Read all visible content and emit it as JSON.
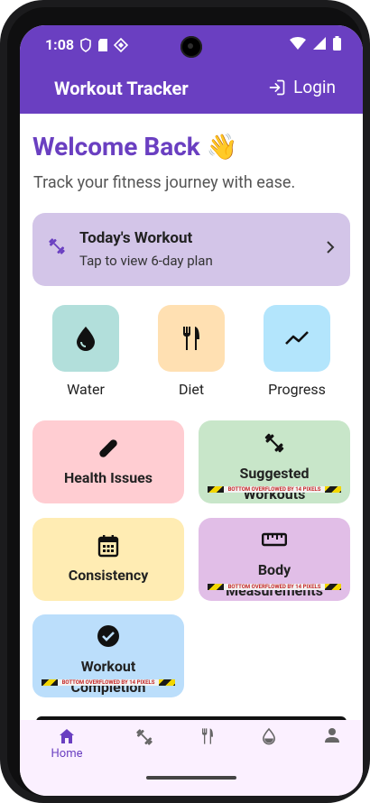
{
  "status_bar": {
    "time": "1:08"
  },
  "app_bar": {
    "title": "Workout Tracker",
    "login_label": "Login"
  },
  "welcome": {
    "title": "Welcome Back 👋",
    "subtitle": "Track your fitness journey with ease."
  },
  "today_card": {
    "title": "Today's Workout",
    "subtitle": "Tap to view 6-day plan"
  },
  "quick_actions": [
    {
      "label": "Water",
      "icon": "water-drop-icon",
      "color": "#b2dfdb"
    },
    {
      "label": "Diet",
      "icon": "fork-knife-icon",
      "color": "#ffe0b2"
    },
    {
      "label": "Progress",
      "icon": "trend-line-icon",
      "color": "#b3e5fc"
    }
  ],
  "tiles": [
    {
      "label": "Health Issues",
      "icon": "bandage-icon",
      "color": "#ffcdd2",
      "overflow": ""
    },
    {
      "label": "Suggested",
      "label_overflow": "Workouts",
      "icon": "dumbbell-icon",
      "color": "#c8e6c9",
      "overflow": "BOTTOM OVERFLOWED BY 14 PIXELS"
    },
    {
      "label": "Consistency",
      "icon": "calendar-icon",
      "color": "#ffecb3",
      "overflow": ""
    },
    {
      "label": "Body",
      "label_overflow": "Measurements",
      "icon": "ruler-icon",
      "color": "#e1bee7",
      "overflow": "BOTTOM OVERFLOWED BY 14 PIXELS"
    },
    {
      "label": "Workout",
      "label_overflow": "Completion",
      "icon": "check-circle-icon",
      "color": "#bbdefb",
      "overflow": "BOTTOM OVERFLOWED BY 14 PIXELS"
    }
  ],
  "bottom_nav": {
    "items": [
      {
        "label": "Home",
        "icon": "home-icon",
        "active": true
      },
      {
        "label": "",
        "icon": "dumbbell-icon",
        "active": false
      },
      {
        "label": "",
        "icon": "fork-knife-icon",
        "active": false
      },
      {
        "label": "",
        "icon": "water-drop-icon",
        "active": false
      },
      {
        "label": "",
        "icon": "person-icon",
        "active": false
      }
    ]
  },
  "colors": {
    "primary": "#6a3fc1",
    "nav_bg": "#fbf0ff"
  }
}
